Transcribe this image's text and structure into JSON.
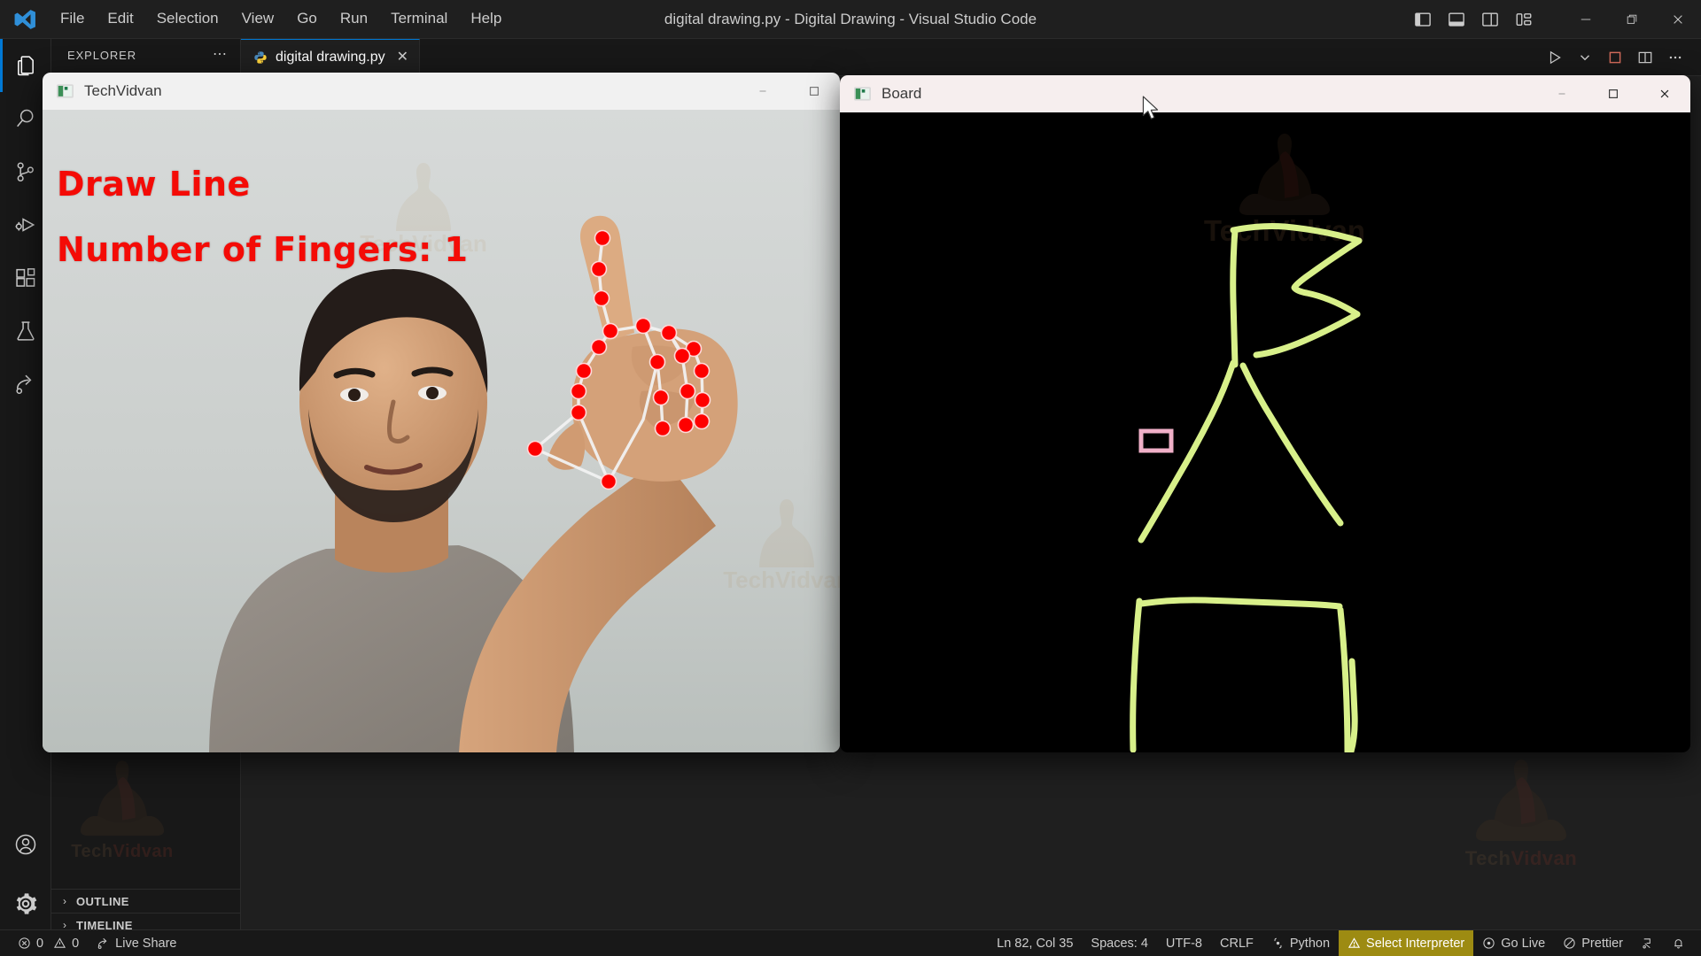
{
  "app": {
    "title": "digital drawing.py - Digital Drawing - Visual Studio Code",
    "menu": [
      "File",
      "Edit",
      "Selection",
      "View",
      "Go",
      "Run",
      "Terminal",
      "Help"
    ],
    "layout_icons": [
      "toggle-primary-sidebar-icon",
      "toggle-panel-icon",
      "toggle-secondary-sidebar-icon",
      "customize-layout-icon"
    ],
    "window_controls": [
      "minimize",
      "restore",
      "close"
    ]
  },
  "activitybar": {
    "items": [
      {
        "name": "explorer",
        "icon": "files-icon",
        "active": true
      },
      {
        "name": "search",
        "icon": "search-icon",
        "active": false
      },
      {
        "name": "source-control",
        "icon": "source-control-icon",
        "active": false
      },
      {
        "name": "run-and-debug",
        "icon": "run-debug-icon",
        "active": false
      },
      {
        "name": "extensions",
        "icon": "extensions-icon",
        "active": false
      },
      {
        "name": "testing",
        "icon": "beaker-icon",
        "active": false
      },
      {
        "name": "live-share",
        "icon": "live-share-icon",
        "active": false
      }
    ],
    "bottom": [
      {
        "name": "accounts",
        "icon": "account-icon"
      },
      {
        "name": "manage",
        "icon": "gear-icon"
      }
    ]
  },
  "sidebar": {
    "title": "EXPLORER",
    "more_actions": "⋯",
    "sections": [
      {
        "label": "OUTLINE",
        "chevron": "›",
        "expanded": false
      },
      {
        "label": "TIMELINE",
        "chevron": "›",
        "expanded": false
      }
    ]
  },
  "editor": {
    "tabs": [
      {
        "label": "digital drawing.py",
        "icon": "python-file-icon",
        "close": "✕",
        "active": true
      }
    ],
    "actions": [
      "run-python-file-icon",
      "run-dropdown-chevron-icon",
      "stop-icon",
      "split-editor-icon",
      "more-actions-icon"
    ]
  },
  "statusbar": {
    "left": [
      {
        "name": "problems",
        "icon": "error-icon",
        "errors": "0",
        "warn_icon": "warning-icon",
        "warnings": "0"
      },
      {
        "name": "live-share",
        "icon": "live-share-icon",
        "label": "Live Share"
      }
    ],
    "right": [
      {
        "name": "cursor-position",
        "label": "Ln 82, Col 35"
      },
      {
        "name": "indentation",
        "label": "Spaces: 4"
      },
      {
        "name": "encoding",
        "label": "UTF-8"
      },
      {
        "name": "eol",
        "label": "CRLF"
      },
      {
        "name": "language-mode",
        "label": "Python",
        "icon": "python-icon"
      },
      {
        "name": "select-interpreter",
        "label": "Select Interpreter",
        "icon": "warning-icon",
        "highlight": "#9d8b12"
      },
      {
        "name": "go-live",
        "label": "Go Live",
        "icon": "broadcast-icon"
      },
      {
        "name": "prettier",
        "label": "Prettier",
        "icon": "prettier-check-icon"
      },
      {
        "name": "remote",
        "label": "",
        "icon": "remote-indicator-icon"
      },
      {
        "name": "notifications",
        "label": "",
        "icon": "bell-icon"
      }
    ]
  },
  "camera_window": {
    "title": "TechVidvan",
    "icon": "opencv-window-icon",
    "controls": [
      "minimize",
      "maximize"
    ],
    "overlay": {
      "mode_text": "Draw Line",
      "fingers_text": "Number of Fingers: 1",
      "text_color": "#f40b06",
      "landmark_color": "#ff0000",
      "connection_color": "#ffffff"
    }
  },
  "board_window": {
    "title": "Board",
    "icon": "opencv-window-icon",
    "controls": [
      "minimize",
      "maximize",
      "close"
    ],
    "canvas": {
      "background": "#000000",
      "stroke_color": "#d8f08a",
      "cursor_rect_color": "#f0b0c8"
    }
  },
  "watermarks": {
    "text_1": "Tech",
    "text_2": "Vidvan",
    "color_1": "#5a4530",
    "color_2": "#6b2d24"
  }
}
